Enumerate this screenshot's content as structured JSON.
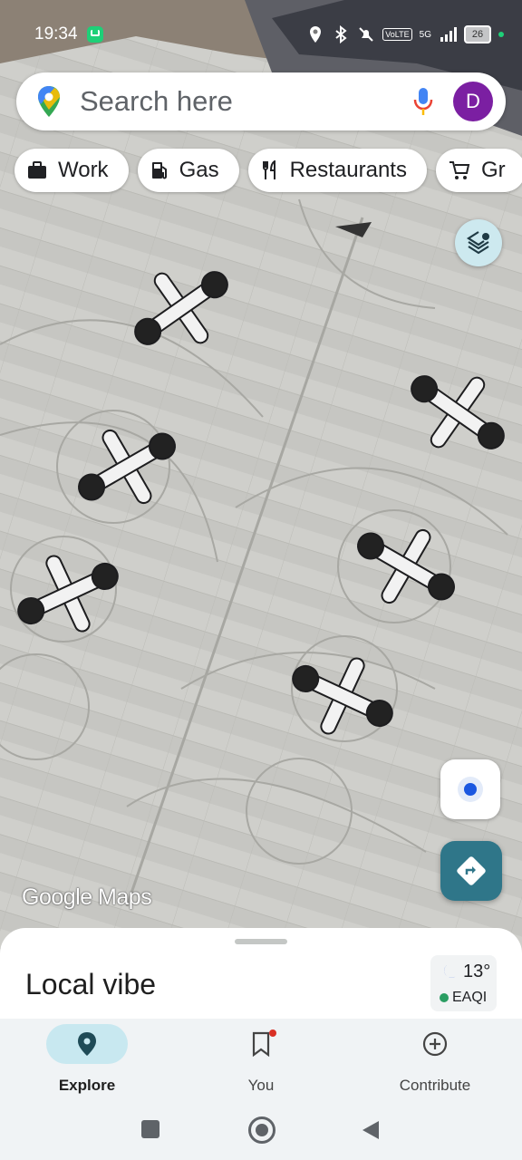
{
  "status_bar": {
    "time": "19:34",
    "network": "5G",
    "volte": "VoLTE",
    "battery": "26"
  },
  "search": {
    "placeholder": "Search here",
    "avatar_letter": "D"
  },
  "chips": [
    {
      "label": "Work",
      "icon": "briefcase-icon"
    },
    {
      "label": "Gas",
      "icon": "gas-pump-icon"
    },
    {
      "label": "Restaurants",
      "icon": "fork-knife-icon"
    },
    {
      "label": "Gr",
      "icon": "cart-icon"
    }
  ],
  "map": {
    "watermark": "Google Maps"
  },
  "sheet": {
    "title": "Local vibe",
    "weather": {
      "temp": "13°",
      "aqi": "EAQI"
    }
  },
  "nav": [
    {
      "label": "Explore",
      "icon": "explore-pin-icon",
      "active": true
    },
    {
      "label": "You",
      "icon": "bookmark-icon",
      "active": false
    },
    {
      "label": "Contribute",
      "icon": "add-circle-icon",
      "active": false
    }
  ],
  "colors": {
    "accent": "#2f7689",
    "avatar": "#7b1fa2",
    "explore_pill": "#c8e8f0",
    "location_dot": "#1a57e0"
  }
}
